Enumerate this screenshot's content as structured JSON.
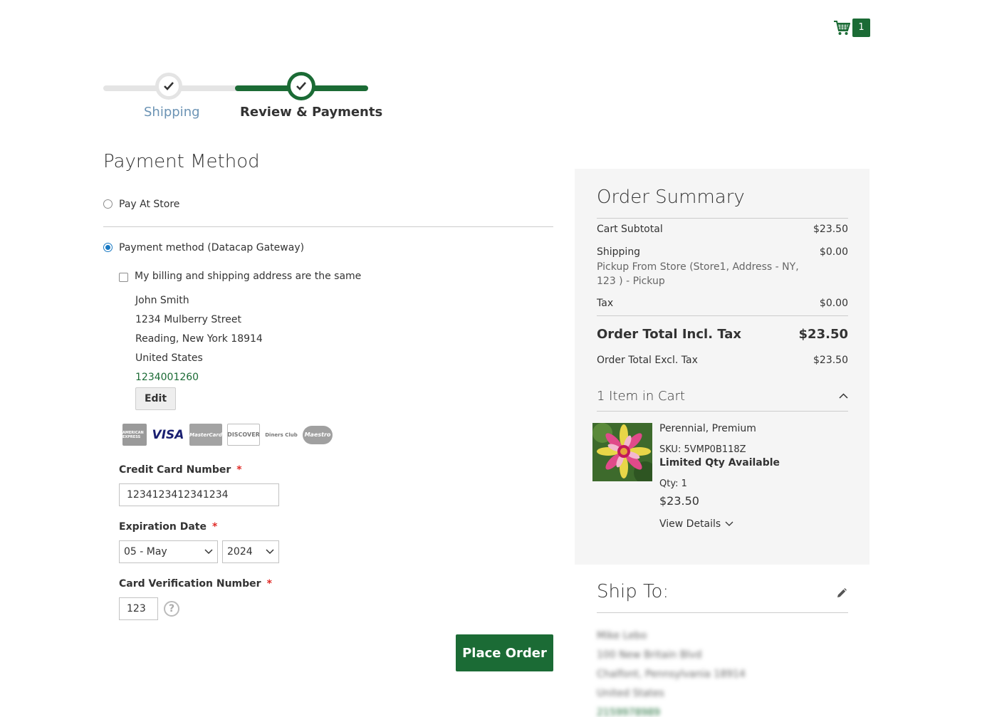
{
  "minicart": {
    "count": "1",
    "icon": "shopping-cart-icon"
  },
  "progress": {
    "steps": [
      {
        "label": "Shipping",
        "state": "complete"
      },
      {
        "label": "Review & Payments",
        "state": "active"
      }
    ]
  },
  "payment": {
    "title": "Payment Method",
    "options": [
      {
        "label": "Pay At Store",
        "selected": false
      },
      {
        "label": "Payment method (Datacap Gateway)",
        "selected": true
      }
    ],
    "same_address_label": "My billing and shipping address are the same",
    "same_address_checked": false,
    "billing_address": {
      "name": "John Smith",
      "street": "1234 Mulberry Street",
      "city_line": "Reading, New York 18914",
      "country": "United States",
      "phone": "1234001260"
    },
    "edit_label": "Edit",
    "cards": [
      "AMERICAN EXPRESS",
      "VISA",
      "MasterCard",
      "DISCOVER",
      "Diners Club",
      "Maestro"
    ],
    "cc_number_label": "Credit Card Number",
    "cc_number_value": "1234123412341234",
    "exp_label": "Expiration Date",
    "exp_month": "05 - May",
    "exp_year": "2024",
    "cvv_label": "Card Verification Number",
    "cvv_value": "123",
    "required_mark": "*",
    "help_glyph": "?",
    "place_order_label": "Place Order"
  },
  "summary": {
    "title": "Order Summary",
    "subtotal_label": "Cart Subtotal",
    "subtotal_value": "$23.50",
    "shipping_label": "Shipping",
    "shipping_value": "$0.00",
    "shipping_method": "Pickup From Store (Store1, Address - NY, 123 ) - Pickup",
    "tax_label": "Tax",
    "tax_value": "$0.00",
    "grand_label": "Order Total Incl. Tax",
    "grand_value": "$23.50",
    "excl_label": "Order Total Excl. Tax",
    "excl_value": "$23.50",
    "items_title": "1 Item in Cart",
    "item": {
      "name": "Perennial, Premium",
      "sku": "SKU: 5VMP0B118Z",
      "limited": "Limited Qty Available",
      "qty": "Qty: 1",
      "price": "$23.50",
      "view_details": "View Details"
    }
  },
  "ship_to": {
    "title": "Ship To:",
    "lines": [
      "Mike Lebo",
      "100 New Britain Blvd",
      "Chalfont, Pennsylvania 18914",
      "United States",
      "2159978989"
    ]
  },
  "colors": {
    "brand_green": "#1b6b35",
    "link_blue": "#6b93b4",
    "radio_blue": "#1979c3",
    "required_red": "#e02b27"
  }
}
